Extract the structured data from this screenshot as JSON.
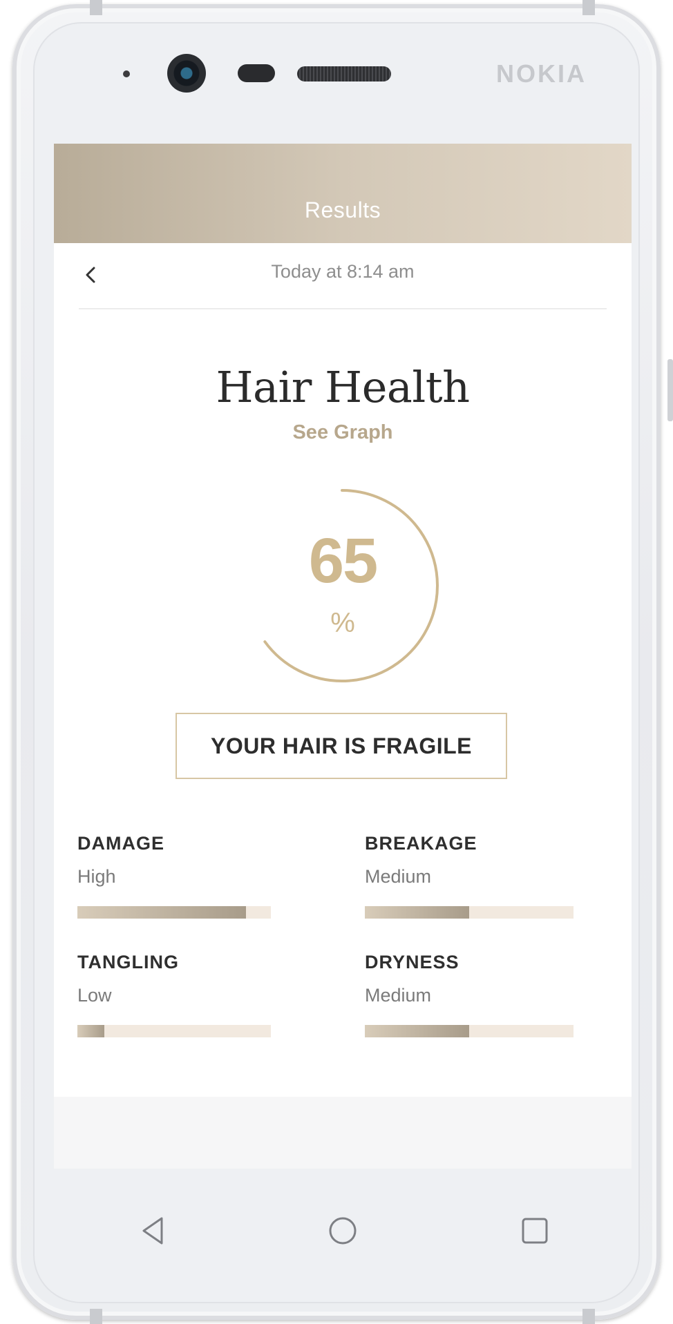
{
  "device": {
    "brand": "NOKIA"
  },
  "header": {
    "title": "Results"
  },
  "subbar": {
    "timestamp": "Today at 8:14 am"
  },
  "result": {
    "title": "Hair Health",
    "see_graph": "See Graph",
    "score": "65",
    "unit": "%",
    "score_fraction": 0.65,
    "verdict": "YOUR HAIR IS FRAGILE"
  },
  "metrics": [
    {
      "name": "DAMAGE",
      "level": "High",
      "fill": 0.87
    },
    {
      "name": "BREAKAGE",
      "level": "Medium",
      "fill": 0.5
    },
    {
      "name": "TANGLING",
      "level": "Low",
      "fill": 0.14
    },
    {
      "name": "DRYNESS",
      "level": "Medium",
      "fill": 0.5
    }
  ],
  "icons": {
    "back": "chevron-left-icon",
    "nav_back": "triangle-left-icon",
    "nav_home": "circle-icon",
    "nav_recents": "square-icon"
  },
  "colors": {
    "accent": "#cfb98f",
    "header_start": "#b8ac98",
    "header_end": "#e2d7c7",
    "bar_track": "#f2e9df",
    "bar_fill": "#a89c8a"
  }
}
